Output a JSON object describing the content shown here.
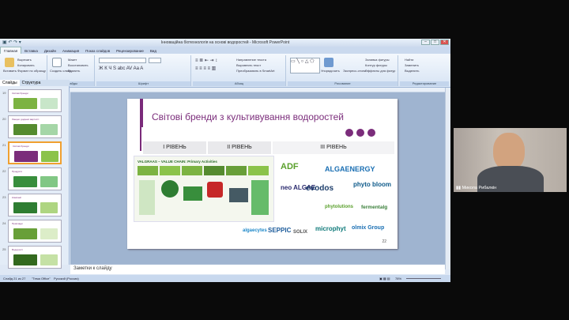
{
  "window": {
    "title": "Інноваційна біотехнологія на основі водоростей - Microsoft PowerPoint",
    "tabs": [
      "Главная",
      "Вставка",
      "Дизайн",
      "Анимация",
      "Показ слайдов",
      "Рецензирование",
      "Вид"
    ]
  },
  "ribbon": {
    "clipboard": {
      "paste": "Вставить",
      "cut": "Вырезать",
      "copy": "Копировать",
      "format": "Формат по образцу",
      "label": "Буфер обмена"
    },
    "slides": {
      "create": "Создать слайд",
      "layout": "Макет",
      "restore": "Восстановить",
      "delete": "Удалить",
      "label": "Слайды"
    },
    "font": {
      "label": "Шрифт"
    },
    "paragraph": {
      "text_dir": "Направление текста",
      "align_text": "Выровнять текст",
      "smartart": "Преобразовать в SmartArt",
      "label": "Абзац"
    },
    "drawing": {
      "arrange": "Упорядочить",
      "quick_styles": "Экспресс-стили",
      "fill": "Заливка фигуры",
      "outline": "Контур фигуры",
      "effects": "Эффекты для фигур",
      "label": "Рисование"
    },
    "editing": {
      "find": "Найти",
      "replace": "Заменить",
      "select": "Выделить",
      "label": "Редактирование"
    }
  },
  "pane": {
    "tab_slides": "Слайды",
    "tab_outline": "Структура",
    "thumbs": [
      {
        "num": "19",
        "title": "Світові бренди"
      },
      {
        "num": "20",
        "title": "Ланцюг доданої вартості"
      },
      {
        "num": "21",
        "title": "Світові бренди"
      },
      {
        "num": "22",
        "title": "Продукти"
      },
      {
        "num": "23",
        "title": "Компанії"
      },
      {
        "num": "24",
        "title": "Приклади"
      },
      {
        "num": "25",
        "title": "Водорості"
      }
    ]
  },
  "slide": {
    "title": "Світові бренди з культивування водоростей",
    "levels": [
      "І РІВЕНЬ",
      "ІІ РІВЕНЬ",
      "ІІІ РІВЕНЬ"
    ],
    "chain_title": "VALGRAAS – VALUE CHAIN: Primary Activities",
    "logos": [
      "ADF",
      "ALGAENERGY",
      "neo ALGAE",
      "evodos",
      "phyto bloom",
      "phytolutions",
      "fermentalg",
      "algaecytes",
      "SEPPIC",
      "SOLIX",
      "microphyt",
      "olmix Group"
    ],
    "number": "22"
  },
  "notes": {
    "placeholder": "Заметки к слайду"
  },
  "statusbar": {
    "slide_of": "Слайд 21 из 27",
    "theme": "\"Тема Office\"",
    "lang": "Русский (Россия)",
    "zoom": "78%"
  },
  "webcam": {
    "name": "Микола Рибалкін"
  }
}
